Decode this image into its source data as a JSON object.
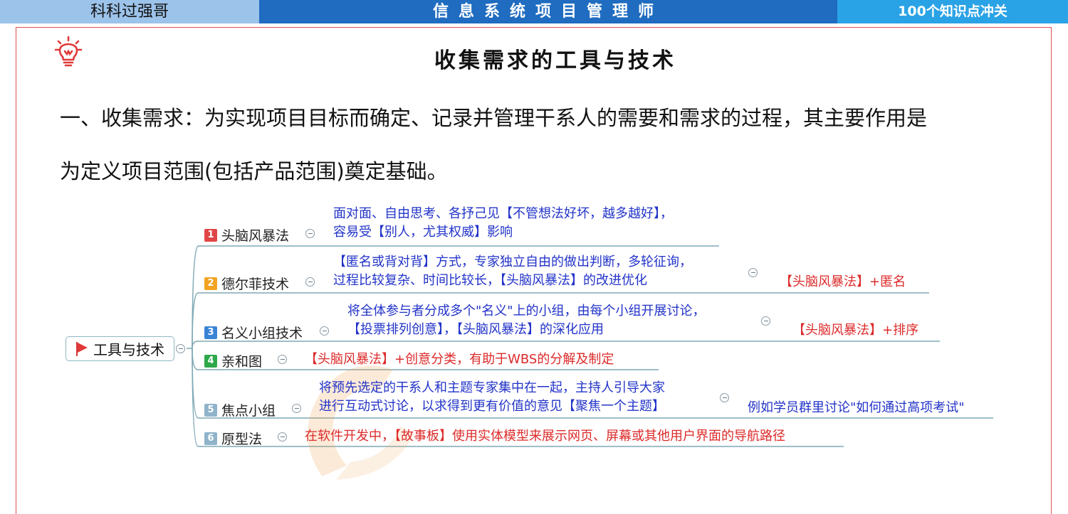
{
  "header": {
    "left_text": "科科过强哥",
    "center_text": "信息系统项目管理师",
    "right_text": "100个知识点冲关"
  },
  "slide": {
    "title": "收集需求的工具与技术",
    "para_line1": "一、收集需求：为实现项目目标而确定、记录并管理干系人的需要和需求的过程，其主要作用是",
    "para_line2": "为定义项目范围(包括产品范围)奠定基础。"
  },
  "mindmap": {
    "root": "工具与技术",
    "branches": [
      {
        "num": "1",
        "color": "#e04646",
        "label": "头脑风暴法",
        "note_line1": "面对面、自由思考、各抒己见【不管想法好坏，越多越好】，",
        "note_line2": "容易受【别人，尤其权威】影响",
        "side": ""
      },
      {
        "num": "2",
        "color": "#f1a321",
        "label": "德尔菲技术",
        "note_line1": "【匿名或背对背】方式，专家独立自由的做出判断，多轮征询，",
        "note_line2": "过程比较复杂、时间比较长，【头脑风暴法】的改进优化",
        "side": "【头脑风暴法】+匿名"
      },
      {
        "num": "3",
        "color": "#3a84d6",
        "label": "名义小组技术",
        "note_line1": "将全体参与者分成多个\"名义\"上的小组，由每个小组开展讨论，",
        "note_line2": "【投票排列创意】，【头脑风暴法】的深化应用",
        "side": "【头脑风暴法】+排序"
      },
      {
        "num": "4",
        "color": "#2fa84a",
        "label": "亲和图",
        "note_line1": "【头脑风暴法】+创意分类，有助于WBS的分解及制定",
        "note_line2": "",
        "side": ""
      },
      {
        "num": "5",
        "color": "#8fb3c9",
        "label": "焦点小组",
        "note_line1": "将预先选定的干系人和主题专家集中在一起，主持人引导大家",
        "note_line2": "进行互动式讨论，以求得到更有价值的意见【聚焦一个主题】",
        "side": "例如学员群里讨论\"如何通过高项考试\""
      },
      {
        "num": "6",
        "color": "#8fb3c9",
        "label": "原型法",
        "note_line1": "在软件开发中，【故事板】使用实体模型来展示网页、屏幕或其他用户界面的导航路径",
        "note_line2": "",
        "side": ""
      }
    ]
  },
  "icons": {
    "bulb": "lightbulb-icon",
    "flag": "flag-icon",
    "collapse": "collapse-circle-icon",
    "watermark": "brand-logo-watermark"
  },
  "colors": {
    "header_left": "#9cc3ea",
    "header_center": "#1f6cc0",
    "header_right": "#2aa3e6",
    "frame": "#e05050",
    "note_blue": "#2233c8",
    "note_red": "#dd2a2a"
  }
}
